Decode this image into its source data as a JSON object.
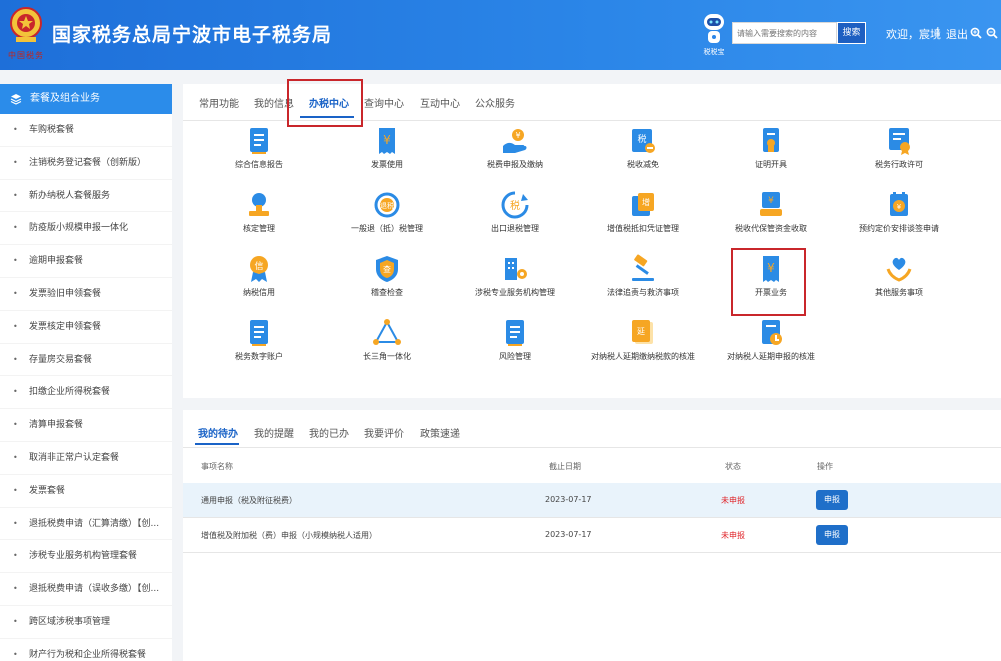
{
  "header": {
    "title": "国家税务总局宁波市电子税务局",
    "emblem_caption": "中国税务",
    "robot_label": "税税宝",
    "search_placeholder": "请输入需要搜索的内容",
    "search_button": "搜索",
    "welcome": "欢迎，宸境",
    "separator": "|",
    "logout": "退出",
    "zoom_in_icon": "zoom-in-icon",
    "zoom_out_icon": "zoom-out-icon"
  },
  "sidebar": {
    "heading": "套餐及组合业务",
    "items": [
      "车购税套餐",
      "注销税务登记套餐（创新版）",
      "新办纳税人套餐服务",
      "防疫版小规模申报一体化",
      "逾期申报套餐",
      "发票验旧申领套餐",
      "发票核定申领套餐",
      "存量房交易套餐",
      "扣缴企业所得税套餐",
      "清算申报套餐",
      "取消非正常户认定套餐",
      "发票套餐",
      "退抵税费申请（汇算清缴）【创...",
      "涉税专业服务机构管理套餐",
      "退抵税费申请（误收多缴）【创...",
      "跨区域涉税事项管理",
      "财产行为税和企业所得税套餐"
    ]
  },
  "main": {
    "tabs": [
      "常用功能",
      "我的信息",
      "办税中心",
      "查询中心",
      "互动中心",
      "公众服务"
    ],
    "active_tab": "办税中心",
    "tiles": [
      {
        "label": "综合信息报告",
        "icon": "document-icon"
      },
      {
        "label": "发票使用",
        "icon": "invoice-yuan-icon"
      },
      {
        "label": "税费申报及缴纳",
        "icon": "hand-coin-icon"
      },
      {
        "label": "税收减免",
        "icon": "tax-reduction-icon"
      },
      {
        "label": "证明开具",
        "icon": "certificate-icon"
      },
      {
        "label": "税务行政许可",
        "icon": "license-icon"
      },
      {
        "label": "核定管理",
        "icon": "stamp-icon"
      },
      {
        "label": "一般退（抵）税管理",
        "icon": "refund-icon"
      },
      {
        "label": "出口退税管理",
        "icon": "export-refund-icon"
      },
      {
        "label": "增值税抵扣凭证管理",
        "icon": "vat-voucher-icon"
      },
      {
        "label": "税收代保管资金收取",
        "icon": "safekeeping-icon"
      },
      {
        "label": "预约定价安排谈签申请",
        "icon": "pricing-arrangement-icon"
      },
      {
        "label": "纳税信用",
        "icon": "credit-medal-icon"
      },
      {
        "label": "稽查检查",
        "icon": "inspection-shield-icon"
      },
      {
        "label": "涉税专业服务机构管理",
        "icon": "building-gear-icon"
      },
      {
        "label": "法律追责与救济事项",
        "icon": "gavel-icon"
      },
      {
        "label": "开票业务",
        "icon": "invoice-issue-icon"
      },
      {
        "label": "其他服务事项",
        "icon": "heart-hands-icon"
      },
      {
        "label": "税务数字账户",
        "icon": "digital-account-icon"
      },
      {
        "label": "长三角一体化",
        "icon": "triangle-network-icon"
      },
      {
        "label": "风险管理",
        "icon": "risk-document-icon"
      },
      {
        "label": "对纳税人延期缴纳税款的核准",
        "icon": "extension-payment-icon"
      },
      {
        "label": "对纳税人延期申报的核准",
        "icon": "extension-declare-icon"
      }
    ]
  },
  "todo": {
    "tabs": [
      "我的待办",
      "我的提醒",
      "我的已办",
      "我要评价",
      "政策速递"
    ],
    "active_tab": "我的待办",
    "columns": [
      "事项名称",
      "截止日期",
      "状态",
      "操作"
    ],
    "rows": [
      {
        "name": "通用申报（税及附征税费）",
        "deadline": "2023-07-17",
        "status": "未申报",
        "action": "申报"
      },
      {
        "name": "增值税及附加税（费）申报（小规模纳税人适用）",
        "deadline": "2023-07-17",
        "status": "未申报",
        "action": "申报"
      }
    ]
  },
  "colors": {
    "header_blue": "#2b86e8",
    "accent": "#1a63c7",
    "highlight_box": "#c9262b",
    "status_red": "#e0262b",
    "icon_blue": "#2b8be5",
    "icon_orange": "#f6a623"
  }
}
